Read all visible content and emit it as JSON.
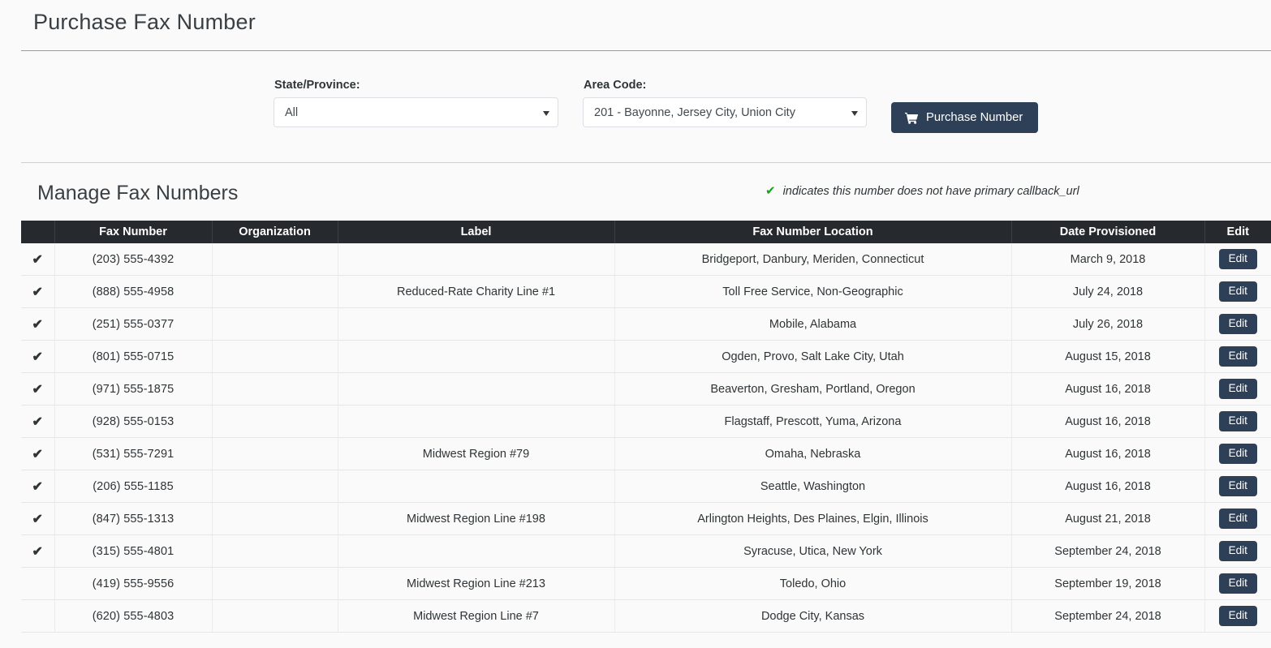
{
  "page": {
    "title": "Purchase Fax Number"
  },
  "purchase_form": {
    "state_label": "State/Province:",
    "state_value": "All",
    "area_label": "Area Code:",
    "area_value": "201 - Bayonne, Jersey City, Union City",
    "purchase_button": "Purchase Number",
    "purchase_icon": "shopping-cart-icon",
    "button_color": "#2e4057"
  },
  "manage": {
    "section_title": "Manage Fax Numbers",
    "legend_mark": "✔",
    "legend_text": "indicates this number does not have primary callback_url",
    "legend_color": "#18a018",
    "columns": [
      "",
      "Fax Number",
      "Organization",
      "Label",
      "Fax Number Location",
      "Date Provisioned",
      "Edit"
    ],
    "edit_label": "Edit",
    "rows": [
      {
        "flag": "✔",
        "number": "(203) 555-4392",
        "organization": "",
        "label": "",
        "location": "Bridgeport, Danbury, Meriden, Connecticut",
        "date": "March 9, 2018",
        "edit": "Edit"
      },
      {
        "flag": "✔",
        "number": "(888) 555-4958",
        "organization": "",
        "label": "Reduced-Rate Charity Line #1",
        "location": "Toll Free Service, Non-Geographic",
        "date": "July 24, 2018",
        "edit": "Edit"
      },
      {
        "flag": "✔",
        "number": "(251) 555-0377",
        "organization": "",
        "label": "",
        "location": "Mobile, Alabama",
        "date": "July 26, 2018",
        "edit": "Edit"
      },
      {
        "flag": "✔",
        "number": "(801) 555-0715",
        "organization": "",
        "label": "",
        "location": "Ogden, Provo, Salt Lake City, Utah",
        "date": "August 15, 2018",
        "edit": "Edit"
      },
      {
        "flag": "✔",
        "number": "(971) 555-1875",
        "organization": "",
        "label": "",
        "location": "Beaverton, Gresham, Portland, Oregon",
        "date": "August 16, 2018",
        "edit": "Edit"
      },
      {
        "flag": "✔",
        "number": "(928) 555-0153",
        "organization": "",
        "label": "",
        "location": "Flagstaff, Prescott, Yuma, Arizona",
        "date": "August 16, 2018",
        "edit": "Edit"
      },
      {
        "flag": "✔",
        "number": "(531) 555-7291",
        "organization": "",
        "label": "Midwest Region #79",
        "location": "Omaha, Nebraska",
        "date": "August 16, 2018",
        "edit": "Edit"
      },
      {
        "flag": "✔",
        "number": "(206) 555-1185",
        "organization": "",
        "label": "",
        "location": "Seattle, Washington",
        "date": "August 16, 2018",
        "edit": "Edit"
      },
      {
        "flag": "✔",
        "number": "(847) 555-1313",
        "organization": "",
        "label": "Midwest Region Line #198",
        "location": "Arlington Heights, Des Plaines, Elgin, Illinois",
        "date": "August 21, 2018",
        "edit": "Edit"
      },
      {
        "flag": "✔",
        "number": "(315) 555-4801",
        "organization": "",
        "label": "",
        "location": "Syracuse, Utica, New York",
        "date": "September 24, 2018",
        "edit": "Edit"
      },
      {
        "flag": "",
        "number": "(419) 555-9556",
        "organization": "",
        "label": "Midwest Region Line #213",
        "location": "Toledo, Ohio",
        "date": "September 19, 2018",
        "edit": "Edit"
      },
      {
        "flag": "",
        "number": "(620) 555-4803",
        "organization": "",
        "label": "Midwest Region Line #7",
        "location": "Dodge City, Kansas",
        "date": "September 24, 2018",
        "edit": "Edit"
      }
    ]
  }
}
